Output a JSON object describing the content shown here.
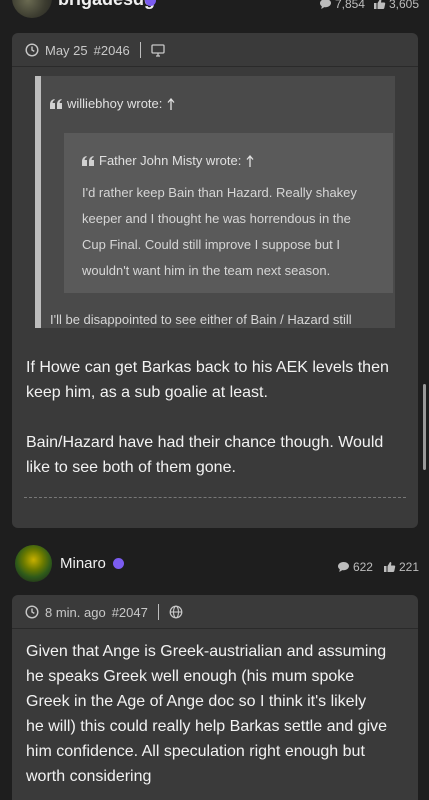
{
  "top_post": {
    "username": "brigadesdg",
    "stats": {
      "comments": "7,854",
      "likes": "3,605"
    }
  },
  "post1": {
    "date": "May 25",
    "post_number": "#2046",
    "quote_outer": {
      "author_line": "williebhoy wrote:",
      "tail_text": "I'll be disappointed to see either of Bain / Hazard still"
    },
    "quote_inner": {
      "author_line": "Father John Misty wrote:",
      "lines": [
        "I'd rather keep Bain than Hazard. Really shakey",
        "keeper and I thought he was horrendous in the",
        "Cup Final. Could still improve I suppose but I",
        "wouldn't want him in the team next season."
      ]
    },
    "body_paragraph_1": [
      "If Howe can get Barkas back to his AEK levels then",
      "keep him, as a sub goalie at least."
    ],
    "body_paragraph_2": [
      "Bain/Hazard have had their chance though. Would",
      "like to see both of them gone."
    ]
  },
  "post2": {
    "username": "Minaro",
    "stats": {
      "comments": "622",
      "likes": "221"
    },
    "date": "8 min. ago",
    "post_number": "#2047",
    "body": [
      "Given that Ange is Greek-austrialian and assuming",
      "he speaks Greek well enough (his mum spoke",
      "Greek in the Age of Ange doc so I think it's likely",
      "he will) this could really help Barkas settle and give",
      "him confidence. All speculation right enough but",
      "worth considering"
    ]
  },
  "colors": {
    "verified": "#7b5cf0",
    "card_bg": "#3a3a3a",
    "page_bg": "#1e1e1e"
  }
}
